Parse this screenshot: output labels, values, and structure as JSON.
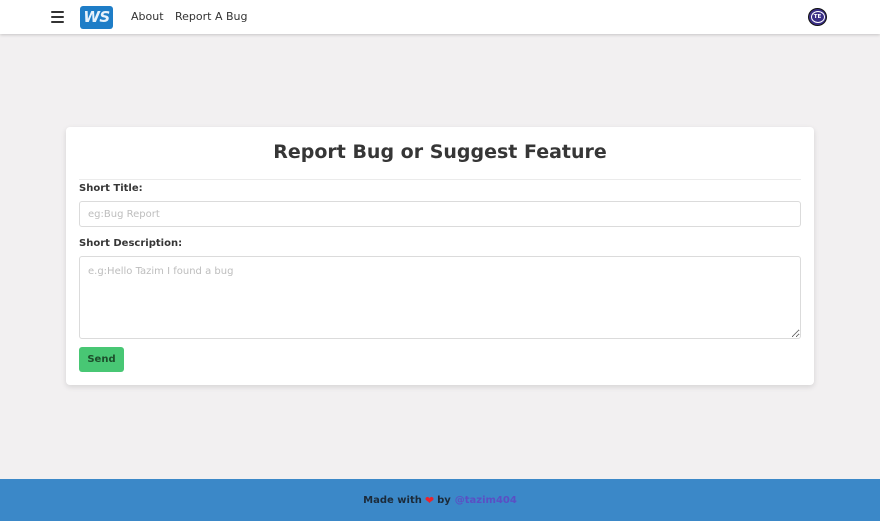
{
  "nav": {
    "logo_text": "WS",
    "links": [
      {
        "label": "About"
      },
      {
        "label": "Report A Bug"
      }
    ],
    "avatar_text": "TE"
  },
  "form": {
    "title": "Report Bug or Suggest Feature",
    "short_title_label": "Short Title:",
    "short_title_placeholder": "eg:Bug Report",
    "short_title_value": "",
    "description_label": "Short Description:",
    "description_placeholder": "e.g:Hello Tazim I found a bug",
    "description_value": "",
    "send_label": "Send"
  },
  "footer": {
    "made_with": "Made with",
    "heart": "❤",
    "by": "by",
    "handle": "@tazim404"
  },
  "colors": {
    "nav_bg": "#ffffff",
    "page_bg": "#f2f0f1",
    "logo_bg": "#1e7dc7",
    "send_button": "#48c774",
    "footer_bg": "#3b88c8",
    "heart": "#e8242d",
    "handle": "#5b4fc4",
    "avatar_bg": "#3a2f86"
  }
}
